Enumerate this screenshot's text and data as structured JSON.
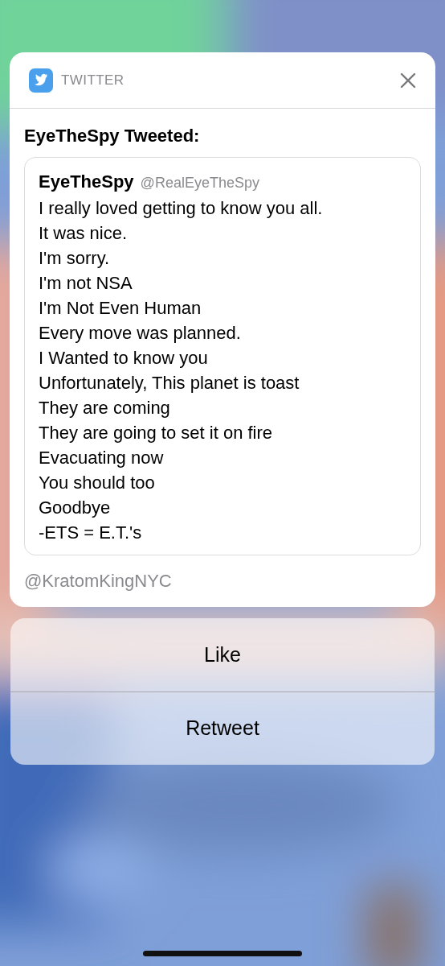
{
  "notification": {
    "app_name": "TWITTER",
    "title": "EyeTheSpy Tweeted:",
    "tweet": {
      "author": "EyeTheSpy",
      "handle": "@RealEyeTheSpy",
      "lines": [
        "I really loved getting to know you all.",
        "It was nice.",
        "I'm sorry.",
        "I'm not NSA",
        "I'm Not Even Human",
        "Every move was planned.",
        "I Wanted to know you",
        "Unfortunately, This planet is toast",
        "They are coming",
        "They are going to set it on fire",
        "Evacuating now",
        "You should too",
        "Goodbye",
        "-ETS = E.T.'s"
      ]
    },
    "footer": "@KratomKingNYC"
  },
  "actions": [
    "Like",
    "Retweet"
  ]
}
